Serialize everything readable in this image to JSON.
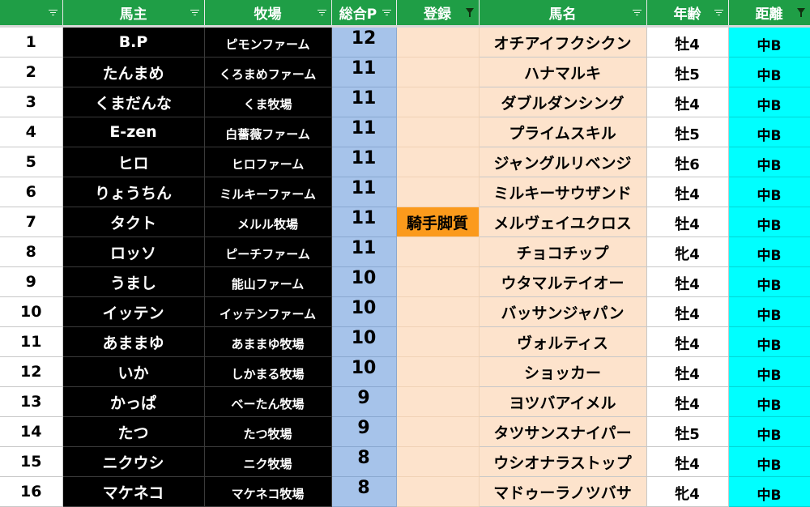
{
  "colors": {
    "header_bg": "#1f9e46",
    "owner_bg": "#000000",
    "points_bg": "#a6c3ea",
    "register_bg": "#fde3cc",
    "register_tag_bg": "#fb9a1c",
    "distance_bg": "#00ffff"
  },
  "headers": {
    "index": "",
    "owner": "馬主",
    "farm": "牧場",
    "points": "総合P",
    "register": "登録",
    "horse": "馬名",
    "age": "年齢",
    "distance": "距離"
  },
  "header_icons": {
    "index": "filter-sort-icon",
    "owner": "filter-sort-icon",
    "farm": "filter-sort-icon",
    "points": "filter-sort-icon",
    "register": "filter-funnel-icon",
    "horse": "filter-sort-icon",
    "age": "filter-sort-icon",
    "distance": "filter-funnel-icon"
  },
  "rows": [
    {
      "num": "1",
      "owner": "B.P",
      "farm": "ピモンファーム",
      "points": "12",
      "register": "",
      "horse": "オチアイフクシクン",
      "age": "牡4",
      "distance": "中B"
    },
    {
      "num": "2",
      "owner": "たんまめ",
      "farm": "くろまめファーム",
      "points": "11",
      "register": "",
      "horse": "ハナマルキ",
      "age": "牡5",
      "distance": "中B"
    },
    {
      "num": "3",
      "owner": "くまだんな",
      "farm": "くま牧場",
      "points": "11",
      "register": "",
      "horse": "ダブルダンシング",
      "age": "牡4",
      "distance": "中B"
    },
    {
      "num": "4",
      "owner": "E-zen",
      "farm": "白薔薇ファーム",
      "points": "11",
      "register": "",
      "horse": "プライムスキル",
      "age": "牡5",
      "distance": "中B"
    },
    {
      "num": "5",
      "owner": "ヒロ",
      "farm": "ヒロファーム",
      "points": "11",
      "register": "",
      "horse": "ジャングルリベンジ",
      "age": "牡6",
      "distance": "中B"
    },
    {
      "num": "6",
      "owner": "りょうちん",
      "farm": "ミルキーファーム",
      "points": "11",
      "register": "",
      "horse": "ミルキーサウザンド",
      "age": "牡4",
      "distance": "中B"
    },
    {
      "num": "7",
      "owner": "タクト",
      "farm": "メルル牧場",
      "points": "11",
      "register": "騎手脚質",
      "horse": "メルヴェイユクロス",
      "age": "牡4",
      "distance": "中B"
    },
    {
      "num": "8",
      "owner": "ロッソ",
      "farm": "ピーチファーム",
      "points": "11",
      "register": "",
      "horse": "チョコチップ",
      "age": "牝4",
      "distance": "中B"
    },
    {
      "num": "9",
      "owner": "うまし",
      "farm": "能山ファーム",
      "points": "10",
      "register": "",
      "horse": "ウタマルテイオー",
      "age": "牡4",
      "distance": "中B"
    },
    {
      "num": "10",
      "owner": "イッテン",
      "farm": "イッテンファーム",
      "points": "10",
      "register": "",
      "horse": "バッサンジャパン",
      "age": "牡4",
      "distance": "中B"
    },
    {
      "num": "11",
      "owner": "あままゆ",
      "farm": "あままゆ牧場",
      "points": "10",
      "register": "",
      "horse": "ヴォルティス",
      "age": "牡4",
      "distance": "中B"
    },
    {
      "num": "12",
      "owner": "いか",
      "farm": "しかまる牧場",
      "points": "10",
      "register": "",
      "horse": "ショッカー",
      "age": "牡4",
      "distance": "中B"
    },
    {
      "num": "13",
      "owner": "かっぱ",
      "farm": "べーたん牧場",
      "points": "9",
      "register": "",
      "horse": "ヨツバアイメル",
      "age": "牡4",
      "distance": "中B"
    },
    {
      "num": "14",
      "owner": "たつ",
      "farm": "たつ牧場",
      "points": "9",
      "register": "",
      "horse": "タツサンスナイパー",
      "age": "牡5",
      "distance": "中B"
    },
    {
      "num": "15",
      "owner": "ニクウシ",
      "farm": "ニク牧場",
      "points": "8",
      "register": "",
      "horse": "ウシオナラストップ",
      "age": "牡4",
      "distance": "中B"
    },
    {
      "num": "16",
      "owner": "マケネコ",
      "farm": "マケネコ牧場",
      "points": "8",
      "register": "",
      "horse": "マドゥーラノツバサ",
      "age": "牝4",
      "distance": "中B"
    }
  ]
}
